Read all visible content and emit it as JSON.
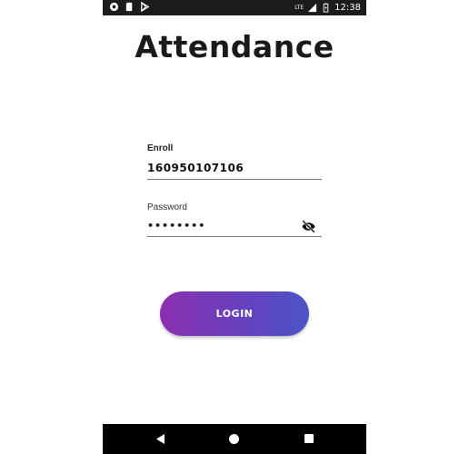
{
  "status_bar": {
    "time": "12:38",
    "network_label": "LTE",
    "left_icons": [
      "circle-notification-icon",
      "sd-card-icon",
      "play-store-icon"
    ],
    "right_icons": [
      "signal-icon",
      "battery-icon"
    ]
  },
  "app": {
    "title": "Attendance"
  },
  "form": {
    "enroll": {
      "label": "Enroll",
      "value": "160950107106"
    },
    "password": {
      "label": "Password",
      "value": "••••••••",
      "visibility_icon": "visibility-off-icon"
    },
    "login_button": {
      "label": "LOGIN"
    }
  },
  "colors": {
    "button_gradient_start": "#8a2fb0",
    "button_gradient_end": "#4a55c5",
    "status_bar": "#1c1c1c",
    "nav_bar": "#000000"
  },
  "nav_bar": {
    "buttons": [
      "back-icon",
      "home-icon",
      "recents-icon"
    ]
  }
}
